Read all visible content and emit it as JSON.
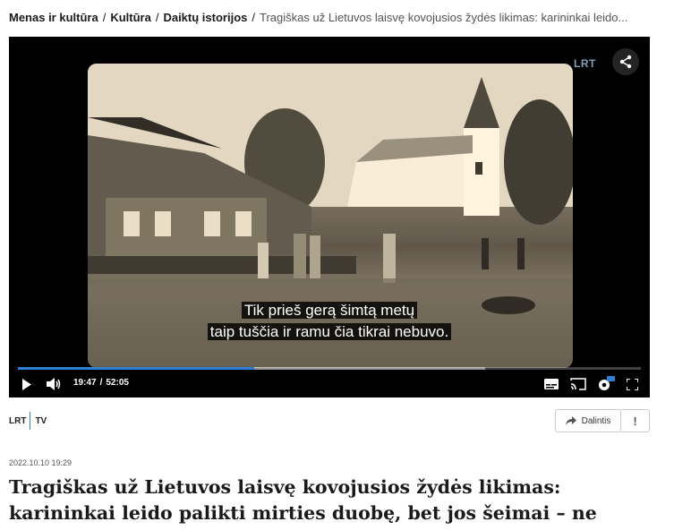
{
  "breadcrumb": {
    "items": [
      "Menas ir kultūra",
      "Kultūra",
      "Daiktų istorijos"
    ],
    "separator": "/",
    "current": "Tragiškas už Lietuvos laisvę kovojusios žydės likimas: karininkai leido..."
  },
  "player": {
    "watermark": "LRT",
    "subtitle_line1": "Tik prieš gerą šimtą metų",
    "subtitle_line2": "taip tuščia ir ramu čia tikrai nebuvo.",
    "current_time": "19:47",
    "separator": "/",
    "duration": "52:05",
    "progress_fraction": 0.38,
    "buffer_fraction": 0.75,
    "accent_color": "#2e7fd6",
    "icons": [
      "share-icon",
      "play-icon",
      "volume-icon",
      "subtitles-icon",
      "cast-icon",
      "settings-icon",
      "fullscreen-icon"
    ],
    "settings_badge": "HD"
  },
  "source": {
    "logo": "LRT",
    "channel": "TV"
  },
  "actions": {
    "share_label": "Dalintis",
    "report_label": "!"
  },
  "article": {
    "date": "2022.10.10 19:29",
    "title": "Tragiškas už Lietuvos laisvę kovojusios žydės likimas: karininkai leido palikti mirties duobę, bet jos šeimai – ne"
  }
}
